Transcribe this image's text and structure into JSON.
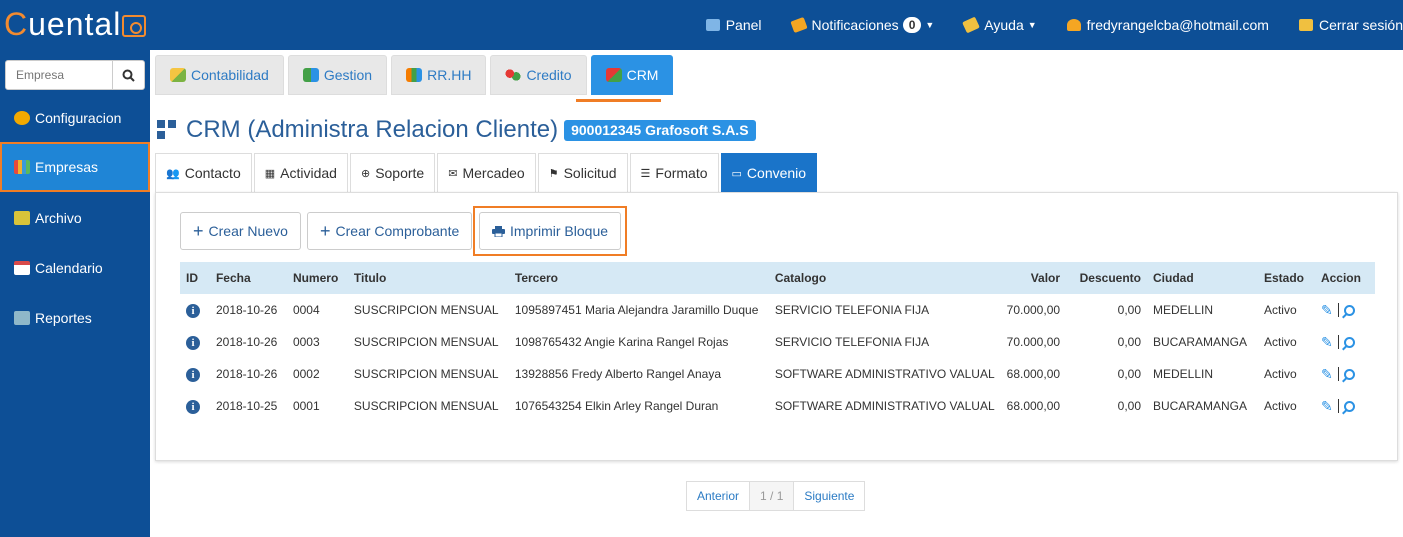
{
  "app": {
    "logo_prefix": "C",
    "logo_rest": "uental"
  },
  "topnav": {
    "panel": "Panel",
    "notifications": "Notificaciones",
    "notifications_count": "0",
    "help": "Ayuda",
    "user": "fredyrangelcba@hotmail.com",
    "logout": "Cerrar sesión"
  },
  "sidebar": {
    "search_placeholder": "Empresa",
    "items": [
      {
        "label": "Configuracion",
        "icon": "gear-icon",
        "color": "#f2a900"
      },
      {
        "label": "Empresas",
        "icon": "books-icon",
        "color": "#e8a32e"
      },
      {
        "label": "Archivo",
        "icon": "folder-icon",
        "color": "#d8c33a"
      },
      {
        "label": "Calendario",
        "icon": "calendar-icon",
        "color": "#d84a4a"
      },
      {
        "label": "Reportes",
        "icon": "printer-icon",
        "color": "#8fb8c9"
      }
    ]
  },
  "modules": [
    {
      "label": "Contabilidad",
      "icon": "coins-icon",
      "color": "#7cb342"
    },
    {
      "label": "Gestion",
      "icon": "blocks-icon",
      "color": "#43a047"
    },
    {
      "label": "RR.HH",
      "icon": "people-icon",
      "color": "#f57c00"
    },
    {
      "label": "Credito",
      "icon": "circles-icon",
      "color": "#e53935"
    },
    {
      "label": "CRM",
      "icon": "cube-icon",
      "color": "#e53935"
    }
  ],
  "page": {
    "title": "CRM (Administra Relacion Cliente)",
    "company": "900012345 Grafosoft S.A.S"
  },
  "subtabs": [
    {
      "label": "Contacto",
      "icon": "contacts-icon"
    },
    {
      "label": "Actividad",
      "icon": "grid-icon"
    },
    {
      "label": "Soporte",
      "icon": "lifebuoy-icon"
    },
    {
      "label": "Mercadeo",
      "icon": "envelope-icon"
    },
    {
      "label": "Solicitud",
      "icon": "flag-icon"
    },
    {
      "label": "Formato",
      "icon": "list-icon"
    },
    {
      "label": "Convenio",
      "icon": "id-card-icon"
    }
  ],
  "actions": {
    "new": "Crear Nuevo",
    "voucher": "Crear Comprobante",
    "print": "Imprimir Bloque"
  },
  "table": {
    "headers": [
      "ID",
      "Fecha",
      "Numero",
      "Titulo",
      "Tercero",
      "Catalogo",
      "Valor",
      "Descuento",
      "Ciudad",
      "Estado",
      "Accion"
    ],
    "rows": [
      {
        "fecha": "2018-10-26",
        "numero": "0004",
        "titulo": "SUSCRIPCION MENSUAL",
        "tercero": "1095897451 Maria Alejandra Jaramillo Duque",
        "catalogo": "SERVICIO TELEFONIA FIJA",
        "valor": "70.000,00",
        "descuento": "0,00",
        "ciudad": "MEDELLIN",
        "estado": "Activo"
      },
      {
        "fecha": "2018-10-26",
        "numero": "0003",
        "titulo": "SUSCRIPCION MENSUAL",
        "tercero": "1098765432 Angie Karina Rangel Rojas",
        "catalogo": "SERVICIO TELEFONIA FIJA",
        "valor": "70.000,00",
        "descuento": "0,00",
        "ciudad": "BUCARAMANGA",
        "estado": "Activo"
      },
      {
        "fecha": "2018-10-26",
        "numero": "0002",
        "titulo": "SUSCRIPCION MENSUAL",
        "tercero": "13928856 Fredy Alberto Rangel Anaya",
        "catalogo": "SOFTWARE ADMINISTRATIVO VALUAL",
        "valor": "68.000,00",
        "descuento": "0,00",
        "ciudad": "MEDELLIN",
        "estado": "Activo"
      },
      {
        "fecha": "2018-10-25",
        "numero": "0001",
        "titulo": "SUSCRIPCION MENSUAL",
        "tercero": "1076543254 Elkin Arley Rangel Duran",
        "catalogo": "SOFTWARE ADMINISTRATIVO VALUAL",
        "valor": "68.000,00",
        "descuento": "0,00",
        "ciudad": "BUCARAMANGA",
        "estado": "Activo"
      }
    ]
  },
  "pager": {
    "prev": "Anterior",
    "current": "1 / 1",
    "next": "Siguiente"
  }
}
